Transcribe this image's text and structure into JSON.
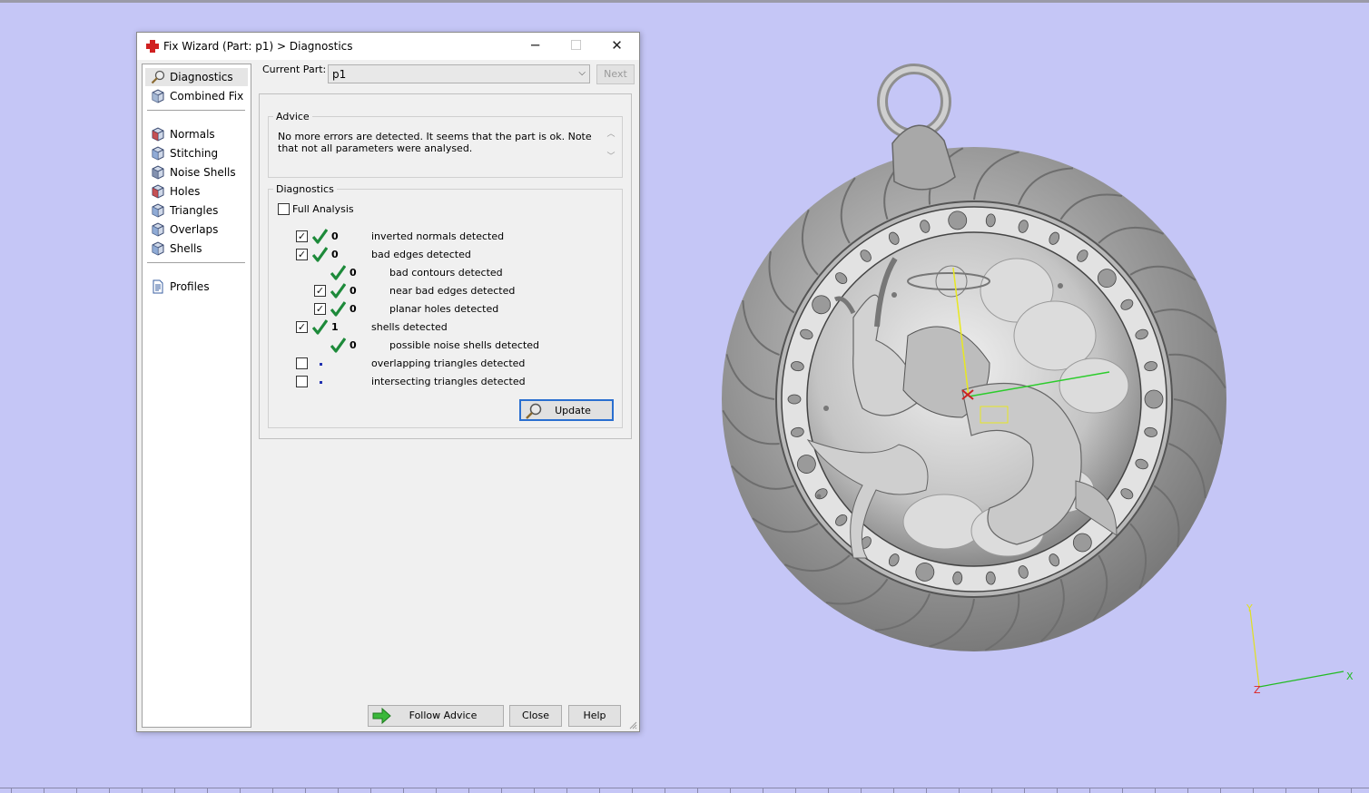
{
  "window": {
    "title": "Fix Wizard (Part: p1) > Diagnostics",
    "controls": {
      "minimize": "─",
      "maximize": "☐",
      "close": "✕"
    }
  },
  "nav": {
    "groups": [
      [
        {
          "label": "Diagnostics",
          "icon": "magnifier-icon",
          "selected": true
        },
        {
          "label": "Combined Fix",
          "icon": "combined-fix-icon"
        }
      ],
      [
        {
          "label": "Normals",
          "icon": "normals-icon"
        },
        {
          "label": "Stitching",
          "icon": "stitching-icon"
        },
        {
          "label": "Noise Shells",
          "icon": "noise-shells-icon"
        },
        {
          "label": "Holes",
          "icon": "holes-icon"
        },
        {
          "label": "Triangles",
          "icon": "triangles-icon"
        },
        {
          "label": "Overlaps",
          "icon": "overlaps-icon"
        },
        {
          "label": "Shells",
          "icon": "shells-icon"
        }
      ],
      [
        {
          "label": "Profiles",
          "icon": "profiles-icon"
        }
      ]
    ]
  },
  "current_part": {
    "label": "Current Part:",
    "value": "p1",
    "next_label": "Next"
  },
  "advice": {
    "title": "Advice",
    "text": "No more errors are detected. It seems that the part is ok. Note that not all parameters were analysed."
  },
  "diagnostics": {
    "title": "Diagnostics",
    "full_analysis_label": "Full Analysis",
    "full_analysis_checked": false,
    "rows": [
      {
        "checkbox": true,
        "checked": true,
        "status": "ok",
        "count": "0",
        "text": "inverted normals detected",
        "indent": 0
      },
      {
        "checkbox": true,
        "checked": true,
        "status": "ok",
        "count": "0",
        "text": "bad edges detected",
        "indent": 0
      },
      {
        "checkbox": false,
        "checked": false,
        "status": "ok",
        "count": "0",
        "text": "bad contours detected",
        "indent": 1
      },
      {
        "checkbox": true,
        "checked": true,
        "status": "ok",
        "count": "0",
        "text": "near bad edges detected",
        "indent": 1
      },
      {
        "checkbox": true,
        "checked": true,
        "status": "ok",
        "count": "0",
        "text": "planar holes detected",
        "indent": 1
      },
      {
        "checkbox": true,
        "checked": true,
        "status": "ok",
        "count": "1",
        "text": "shells detected",
        "indent": 0
      },
      {
        "checkbox": false,
        "checked": false,
        "status": "ok",
        "count": "0",
        "text": "possible noise shells detected",
        "indent": 1
      },
      {
        "checkbox": true,
        "checked": false,
        "status": "not-run",
        "count": "",
        "text": "overlapping triangles detected",
        "indent": 0
      },
      {
        "checkbox": true,
        "checked": false,
        "status": "not-run",
        "count": "",
        "text": "intersecting triangles detected",
        "indent": 0
      }
    ],
    "update_label": "Update"
  },
  "buttons": {
    "follow_advice": "Follow Advice",
    "close": "Close",
    "help": "Help"
  },
  "viewport": {
    "background": "#c5c6f6",
    "model": "zodiac-pendant-model",
    "axes": {
      "x": "X",
      "y": "Y",
      "z": "Z"
    }
  },
  "colors": {
    "check": "#1d8a3a",
    "focus": "#2a6fd0",
    "axis_x": "#22bb22",
    "axis_y": "#dddd22",
    "axis_z": "#dd2222"
  }
}
